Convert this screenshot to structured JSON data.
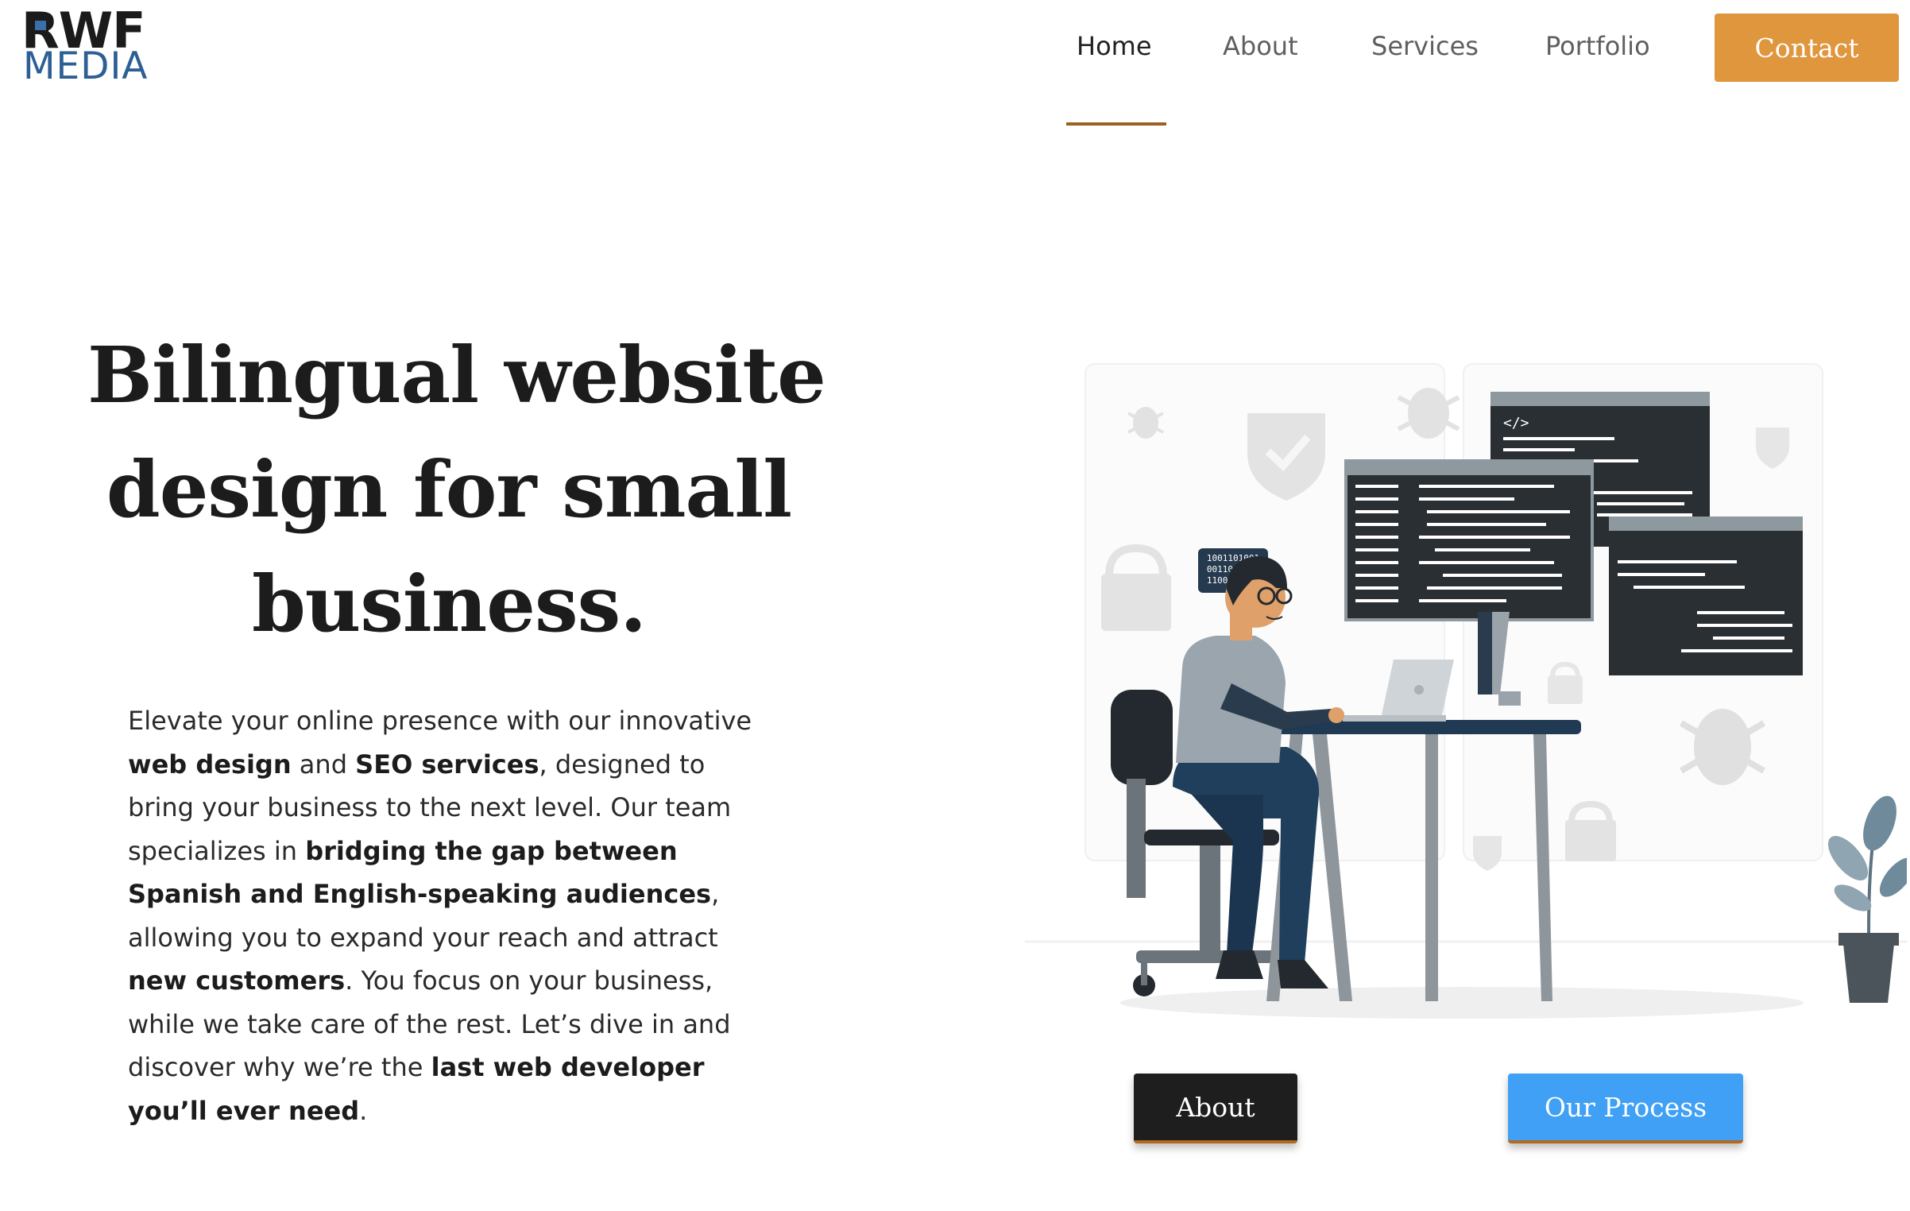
{
  "brand": {
    "logo_top": "RWF",
    "logo_bottom": "MEDIA",
    "colors": {
      "dark": "#1b1b1b",
      "blue": "#2d5e95",
      "accent": "#e0963d",
      "underline": "#9a6220"
    }
  },
  "nav": {
    "items": [
      {
        "label": "Home",
        "active": true
      },
      {
        "label": "About",
        "active": false
      },
      {
        "label": "Services",
        "active": false
      },
      {
        "label": "Portfolio",
        "active": false
      }
    ],
    "contact_label": "Contact"
  },
  "hero": {
    "title_lines": [
      "Bilingual website",
      "design for small",
      "business."
    ],
    "body": {
      "l1": "Elevate your online presence with our innovative",
      "l2_b1": "web design",
      "l2_t1": " and ",
      "l2_b2": "SEO services",
      "l2_t2": ", designed to",
      "l3": "bring your business to the next level. Our team",
      "l4_t1": "specializes in ",
      "l4_b1": "bridging the gap between",
      "l5_b1": "Spanish and English-speaking audiences",
      "l5_t1": ",",
      "l6": "allowing you to expand your reach and attract",
      "l7_b1": "new customers",
      "l7_t1": ". You focus on your business,",
      "l8": "while we take care of the rest. Let’s dive in and",
      "l9_t1": "discover why we’re the ",
      "l9_b1": "last web developer",
      "l10_b1": "you’ll ever need",
      "l10_t1": "."
    }
  },
  "illustration": {
    "icons": [
      "developer-person-icon",
      "laptop-icon",
      "code-window-icon",
      "bug-icon",
      "shield-check-icon",
      "padlock-icon",
      "plant-icon"
    ],
    "code_tag": "</>",
    "binary_lines": [
      "1001101001",
      "0011010011",
      "1100110010"
    ]
  },
  "cta": {
    "about_label": "About",
    "process_label": "Our Process",
    "colors": {
      "about_bg": "#1e1e1e",
      "process_bg": "#3fa0f5"
    }
  }
}
